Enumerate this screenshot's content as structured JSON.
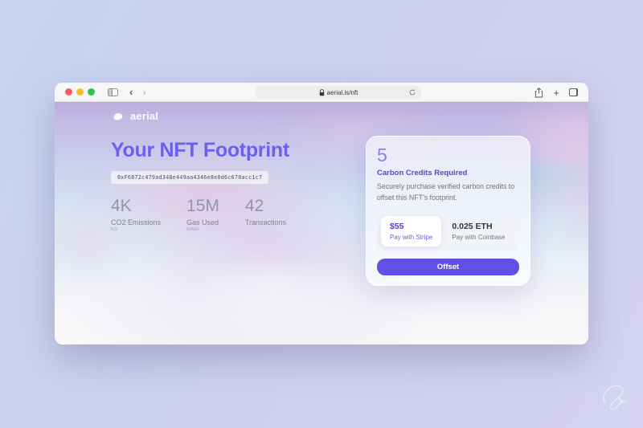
{
  "desktop": {
    "background_top_left": "#c8d4f1",
    "background_bottom_right": "#d5d3f1"
  },
  "browser": {
    "url": "aerial.is/nft",
    "traffic_lights": [
      {
        "name": "close",
        "color": "#f4605a"
      },
      {
        "name": "minimize",
        "color": "#f8bd2d"
      },
      {
        "name": "zoom",
        "color": "#2fc748"
      }
    ],
    "glyphs": {
      "back": "‹",
      "forward": "›",
      "new_tab": "+"
    },
    "icons": [
      "sidebar-icon",
      "back-icon",
      "forward-icon",
      "contrast-icon",
      "lock-icon",
      "reload-icon",
      "share-icon",
      "new-tab-icon",
      "tabs-icon"
    ]
  },
  "page": {
    "brand": {
      "name": "aerial",
      "icon": "aerial-cloud-logo-icon"
    },
    "title": "Your NFT Footprint",
    "wallet_hash": "0xF6872c479ad348e449aa4346e8e0d6c678acc1c7",
    "title_color": "#6b61ec",
    "accent_color": "#6150e8",
    "stats": [
      {
        "value": "4K",
        "label": "CO2 Emissions",
        "unit": "KG"
      },
      {
        "value": "15M",
        "label": "Gas Used",
        "unit": "GWEI"
      },
      {
        "value": "42",
        "label": "Transactions",
        "unit": ""
      }
    ],
    "offset_card": {
      "credits_value": "5",
      "credits_label": "Carbon Credits Required",
      "description": "Securely purchase verified carbon credits to offset this NFT's footprint.",
      "stripe_option": {
        "amount": "$55",
        "label": "Pay with Stripe"
      },
      "coinbase_option": {
        "amount": "0.025 ETH",
        "label": "Pay with Coinbase"
      },
      "offset_button_label": "Offset"
    }
  }
}
